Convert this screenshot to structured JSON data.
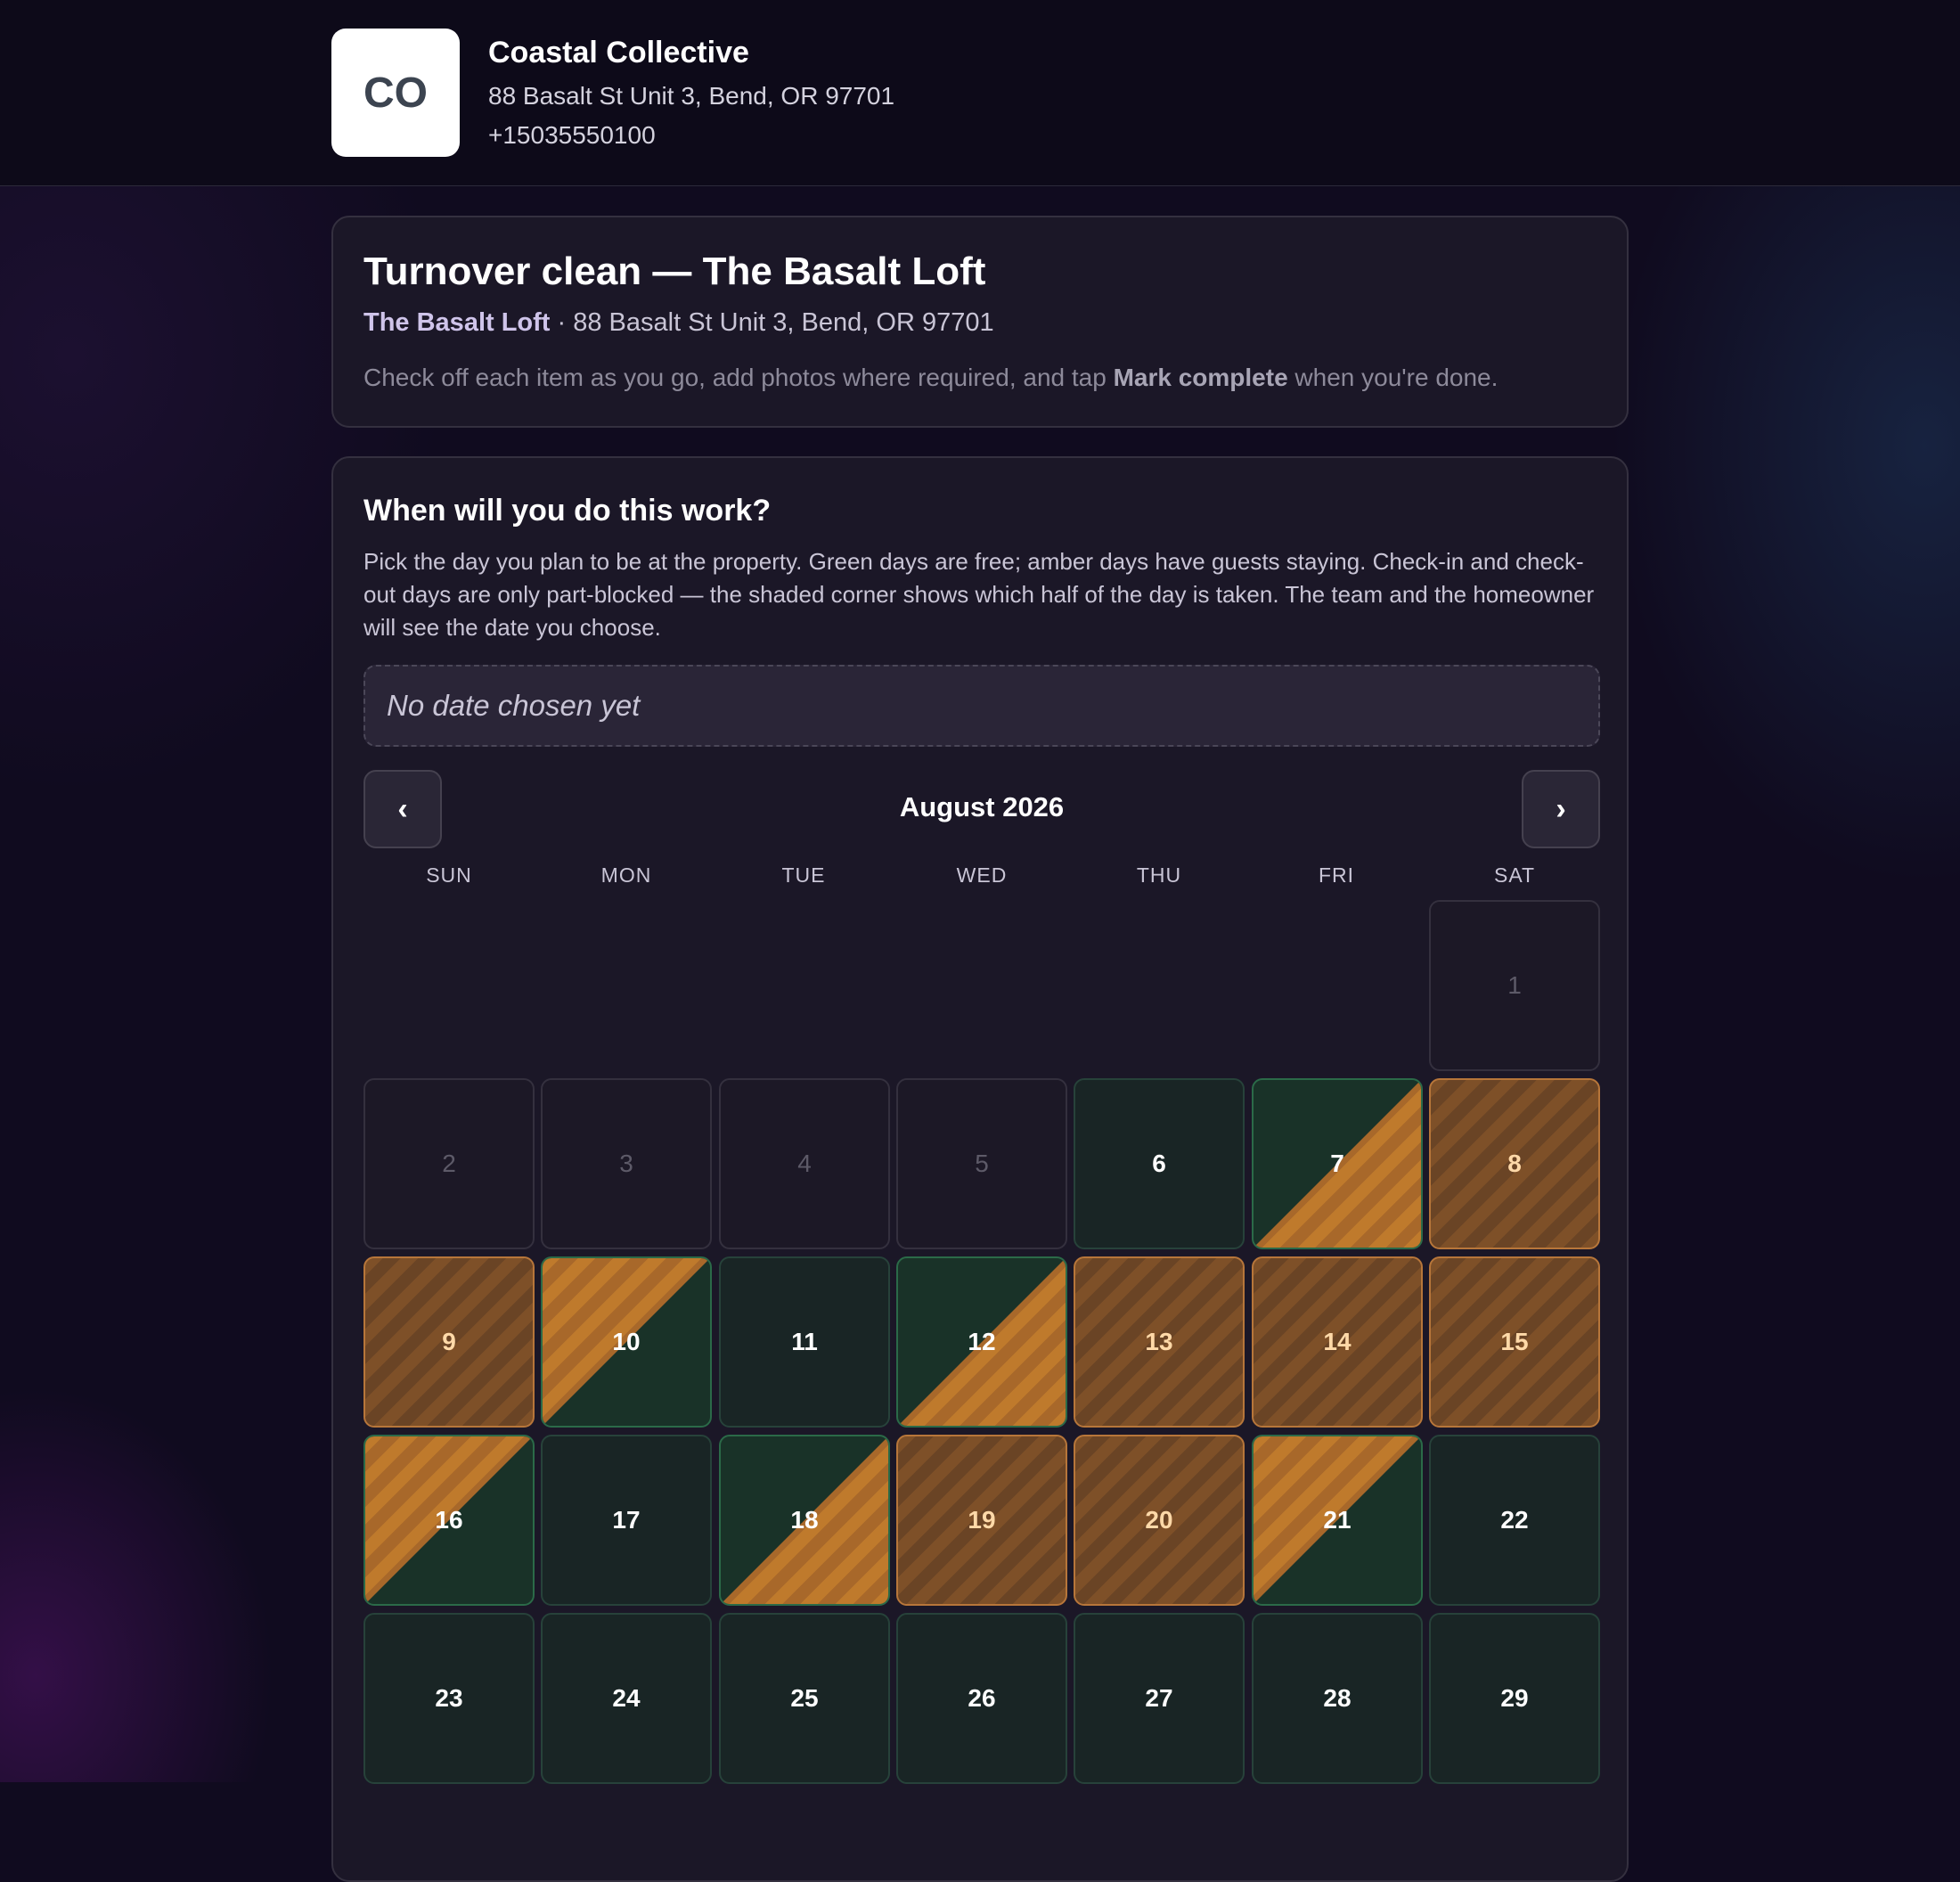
{
  "company": {
    "logo_text": "CO",
    "name": "Coastal Collective",
    "address": "88 Basalt St Unit 3, Bend, OR 97701",
    "phone": "+15035550100"
  },
  "task": {
    "title": "Turnover clean — The Basalt Loft",
    "property_name": "The Basalt Loft",
    "property_address": " · 88 Basalt St Unit 3, Bend, OR 97701",
    "instructions_before": "Check off each item as you go, add photos where required, and tap ",
    "instructions_bold": "Mark complete",
    "instructions_after": " when you're done."
  },
  "schedule": {
    "heading": "When will you do this work?",
    "description": "Pick the day you plan to be at the property. Green days are free; amber days have guests staying. Check-in and check-out days are only part-blocked — the shaded corner shows which half of the day is taken. The team and the homeowner will see the date you choose.",
    "selected_placeholder": "No date chosen yet",
    "prev_label": "‹",
    "next_label": "›",
    "month_label": "August 2026",
    "weekdays": [
      "SUN",
      "MON",
      "TUE",
      "WED",
      "THU",
      "FRI",
      "SAT"
    ],
    "colors": {
      "free": "#192525",
      "booked": "#b7763a",
      "past": "#1c1826"
    },
    "days": [
      {
        "day": 1,
        "status": "past"
      },
      {
        "day": 2,
        "status": "past"
      },
      {
        "day": 3,
        "status": "past"
      },
      {
        "day": 4,
        "status": "past"
      },
      {
        "day": 5,
        "status": "past"
      },
      {
        "day": 6,
        "status": "free"
      },
      {
        "day": 7,
        "status": "checkin"
      },
      {
        "day": 8,
        "status": "booked"
      },
      {
        "day": 9,
        "status": "booked"
      },
      {
        "day": 10,
        "status": "checkout"
      },
      {
        "day": 11,
        "status": "free"
      },
      {
        "day": 12,
        "status": "checkin"
      },
      {
        "day": 13,
        "status": "booked"
      },
      {
        "day": 14,
        "status": "booked"
      },
      {
        "day": 15,
        "status": "booked"
      },
      {
        "day": 16,
        "status": "checkout"
      },
      {
        "day": 17,
        "status": "free"
      },
      {
        "day": 18,
        "status": "checkin"
      },
      {
        "day": 19,
        "status": "booked"
      },
      {
        "day": 20,
        "status": "booked"
      },
      {
        "day": 21,
        "status": "checkout"
      },
      {
        "day": 22,
        "status": "free"
      },
      {
        "day": 23,
        "status": "free"
      },
      {
        "day": 24,
        "status": "free"
      },
      {
        "day": 25,
        "status": "free"
      },
      {
        "day": 26,
        "status": "free"
      },
      {
        "day": 27,
        "status": "free"
      },
      {
        "day": 28,
        "status": "free"
      },
      {
        "day": 29,
        "status": "free"
      }
    ]
  }
}
